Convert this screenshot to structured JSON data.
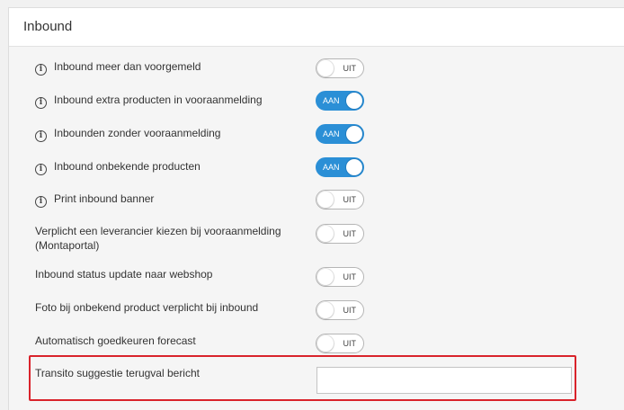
{
  "panel": {
    "title": "Inbound"
  },
  "settings": [
    {
      "label": "Inbound meer dan voorgemeld",
      "info_icon": true,
      "state": "UIT",
      "on": false
    },
    {
      "label": "Inbound extra producten in vooraanmelding",
      "info_icon": true,
      "state": "AAN",
      "on": true
    },
    {
      "label": "Inbounden zonder vooraanmelding",
      "info_icon": true,
      "state": "AAN",
      "on": true
    },
    {
      "label": "Inbound onbekende producten",
      "info_icon": true,
      "state": "AAN",
      "on": true
    },
    {
      "label": "Print inbound banner",
      "info_icon": true,
      "state": "UIT",
      "on": false
    },
    {
      "label": "Verplicht een leverancier kiezen bij vooraanmelding",
      "label_line2": "(Montaportal)",
      "info_icon": false,
      "state": "UIT",
      "on": false
    },
    {
      "label": "Inbound status update naar webshop",
      "info_icon": false,
      "state": "UIT",
      "on": false
    },
    {
      "label": "Foto bij onbekend product verplicht bij inbound",
      "info_icon": false,
      "state": "UIT",
      "on": false
    },
    {
      "label": "Automatisch goedkeuren forecast",
      "info_icon": false,
      "state": "UIT",
      "on": false
    }
  ],
  "text_setting": {
    "label": "Transito suggestie terugval bericht",
    "value": ""
  },
  "icons": {
    "info": "info-circle-icon"
  },
  "colors": {
    "toggle_on": "#2b8fd6",
    "highlight": "#d9232b"
  }
}
